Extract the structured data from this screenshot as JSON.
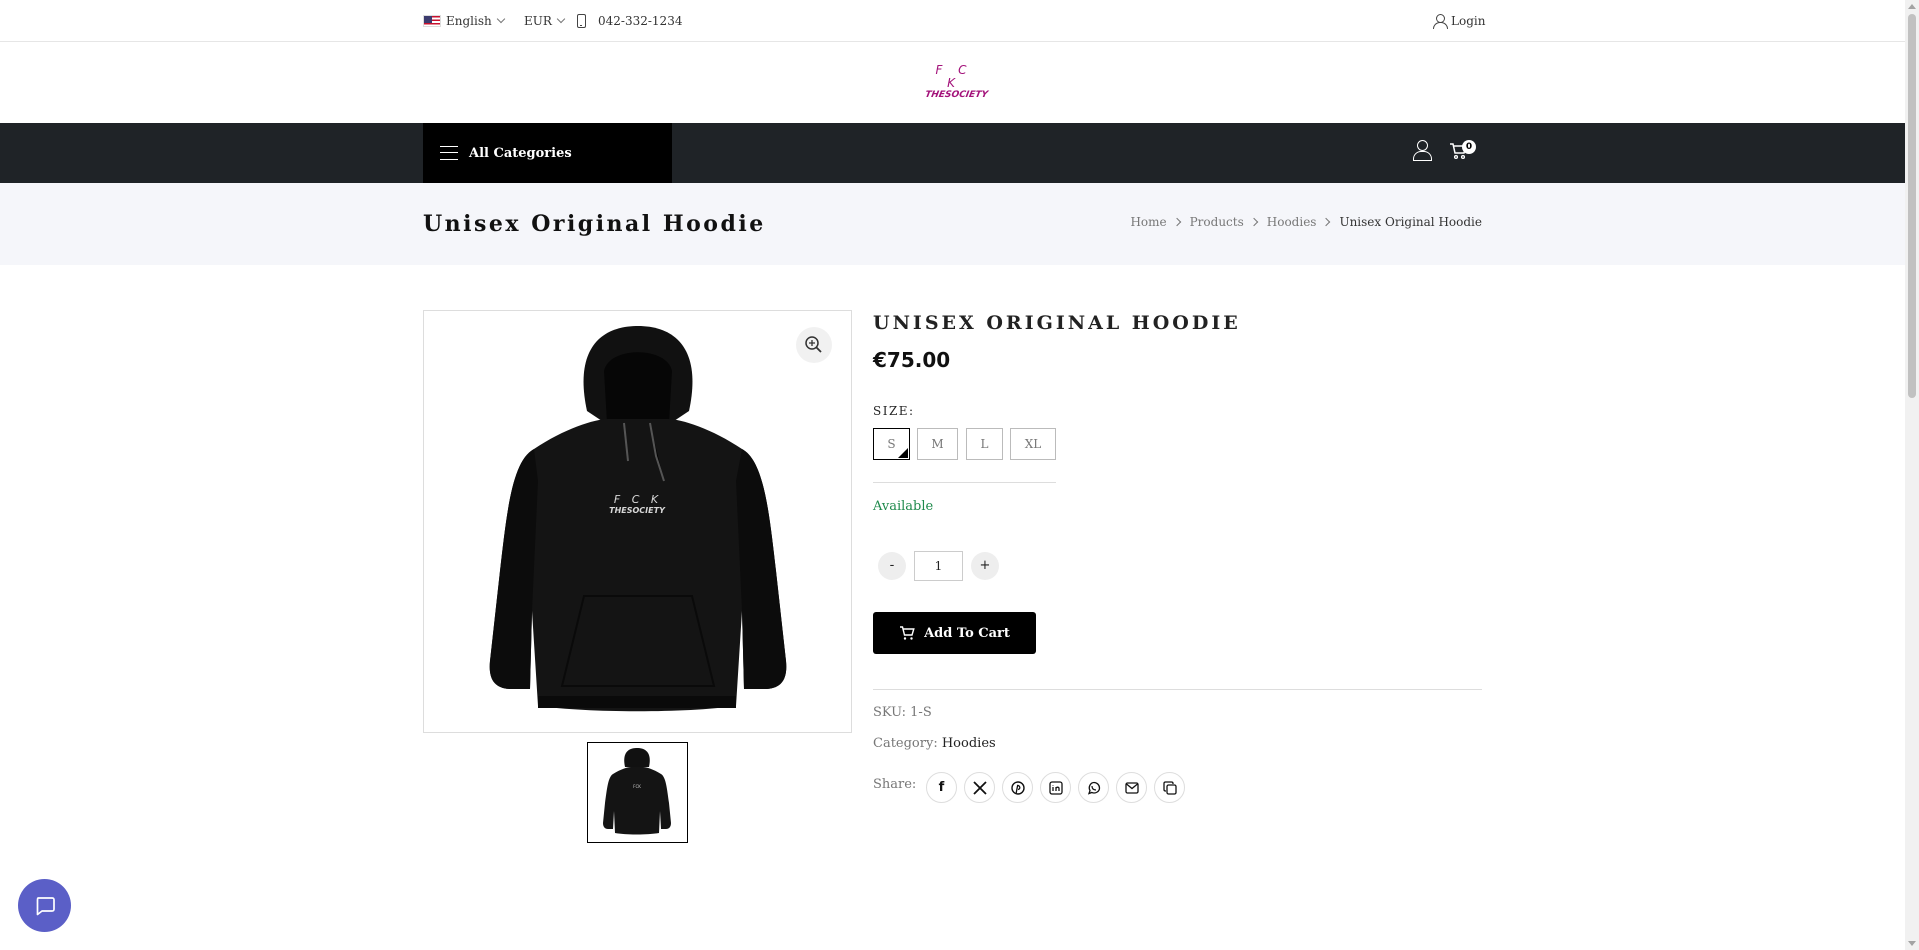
{
  "topbar": {
    "language": "English",
    "currency": "EUR",
    "phone": "042-332-1234",
    "login": "Login"
  },
  "logo": {
    "line1": "F C K",
    "line2": "THESOCIETY",
    "color": "#a3127a"
  },
  "nav": {
    "all_categories": "All Categories",
    "cart_count": "0"
  },
  "page": {
    "title": "Unisex Original Hoodie",
    "breadcrumb": [
      "Home",
      "Products",
      "Hoodies",
      "Unisex Original Hoodie"
    ]
  },
  "product": {
    "name": "UNISEX ORIGINAL HOODIE",
    "price": "€75.00",
    "size_label": "SIZE:",
    "sizes": [
      "S",
      "M",
      "L",
      "XL"
    ],
    "selected_size": "S",
    "availability": "Available",
    "quantity": "1",
    "minus": "-",
    "plus": "+",
    "add_to_cart": "Add To Cart",
    "sku_label": "SKU: 1-S",
    "category_label": "Category:",
    "category": "Hoodies",
    "share_label": "Share:",
    "share_icons": [
      "facebook-icon",
      "x-icon",
      "pinterest-icon",
      "linkedin-icon",
      "whatsapp-icon",
      "mail-icon",
      "copy-icon"
    ],
    "available_color": "#1f8a4c"
  },
  "chat": {
    "icon": "chat-icon",
    "color": "#5b5fc7"
  }
}
